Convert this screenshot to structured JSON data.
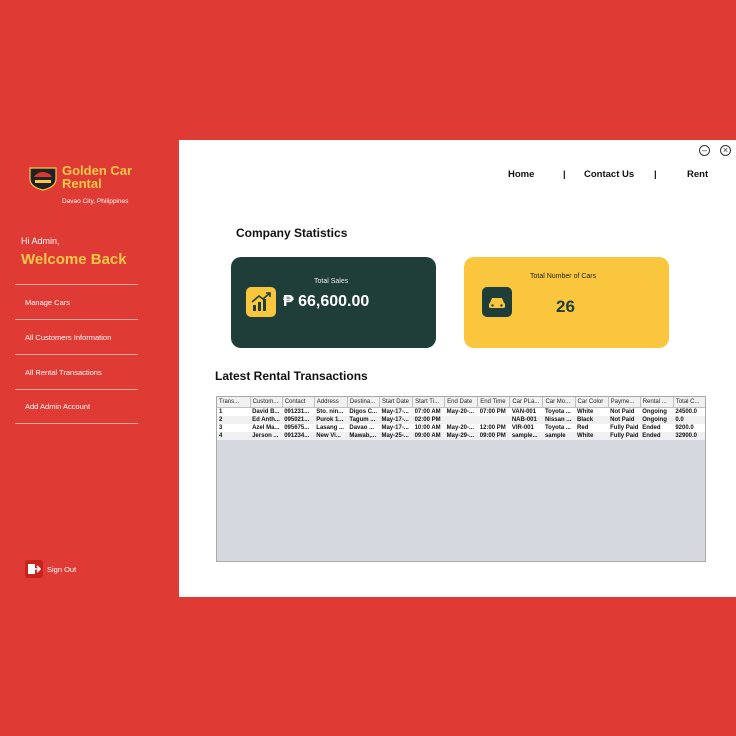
{
  "sidebar": {
    "brand": "Golden Car Rental",
    "location": "Davao City, Philippines",
    "greeting": "Hi Admin,",
    "welcome": "Welcome Back",
    "items": [
      {
        "label": "Manage Cars"
      },
      {
        "label": "All Customers Information"
      },
      {
        "label": "All Rental Transactions"
      },
      {
        "label": "Add Admin Account"
      }
    ],
    "signout": "Sign Out"
  },
  "topnav": {
    "home": "Home",
    "sep1": "|",
    "contact": "Contact Us",
    "sep2": "|",
    "rent": "Rent"
  },
  "window": {
    "minimize": "–",
    "close": "×"
  },
  "stats": {
    "title": "Company Statistics",
    "sales_label": "Total Sales",
    "sales_value": "₱ 66,600.00",
    "cars_label": "Total Number of Cars",
    "cars_value": "26"
  },
  "transactions": {
    "title": "Latest Rental Transactions",
    "columns": [
      "Trans...",
      "Custom...",
      "Contact",
      "Address",
      "Destina...",
      "Start Date",
      "Start Ti...",
      "End Date",
      "End Time",
      "Car PLa...",
      "Car Mo...",
      "Car Color",
      "Payme...",
      "Rental ...",
      "Total C..."
    ],
    "rows": [
      [
        "1",
        "David B...",
        "091231...",
        "Sto. nin...",
        "Digos C...",
        "May-17-...",
        "07:00 AM",
        "May-20-...",
        "07:00 PM",
        "VAN-001",
        "Toyota ...",
        "White",
        "Not Paid",
        "Ongoing",
        "24500.0"
      ],
      [
        "2",
        "Ed Anth...",
        "095021...",
        "Purok 1...",
        "Tagum ...",
        "May-17-...",
        "02:00 PM",
        "",
        "",
        "NAB-001",
        "Nissan ...",
        "Black",
        "Not Paid",
        "Ongoing",
        "0.0"
      ],
      [
        "3",
        "Azel Ma...",
        "095675...",
        "Lasang ...",
        "Davao ...",
        "May-17-...",
        "10:00 AM",
        "May-20-...",
        "12:00 PM",
        "VIR-001",
        "Toyota ...",
        "Red",
        "Fully Paid",
        "Ended",
        "9200.0"
      ],
      [
        "4",
        "Jerson ...",
        "091234...",
        "New Vi...",
        "Mawab,...",
        "May-25-...",
        "09:00 AM",
        "May-29-...",
        "09:00 PM",
        "sample...",
        "sample",
        "White",
        "Fully Paid",
        "Ended",
        "32900.0"
      ]
    ]
  },
  "colors": {
    "background": "#e03a34",
    "accent": "#f7c94a",
    "sales_card": "#1f3e3a",
    "cars_card": "#f9c63e"
  },
  "icons": {
    "logo": "car-logo-badge",
    "sales": "growth-chart-icon",
    "cars": "car-icon",
    "signout": "signout-icon"
  }
}
